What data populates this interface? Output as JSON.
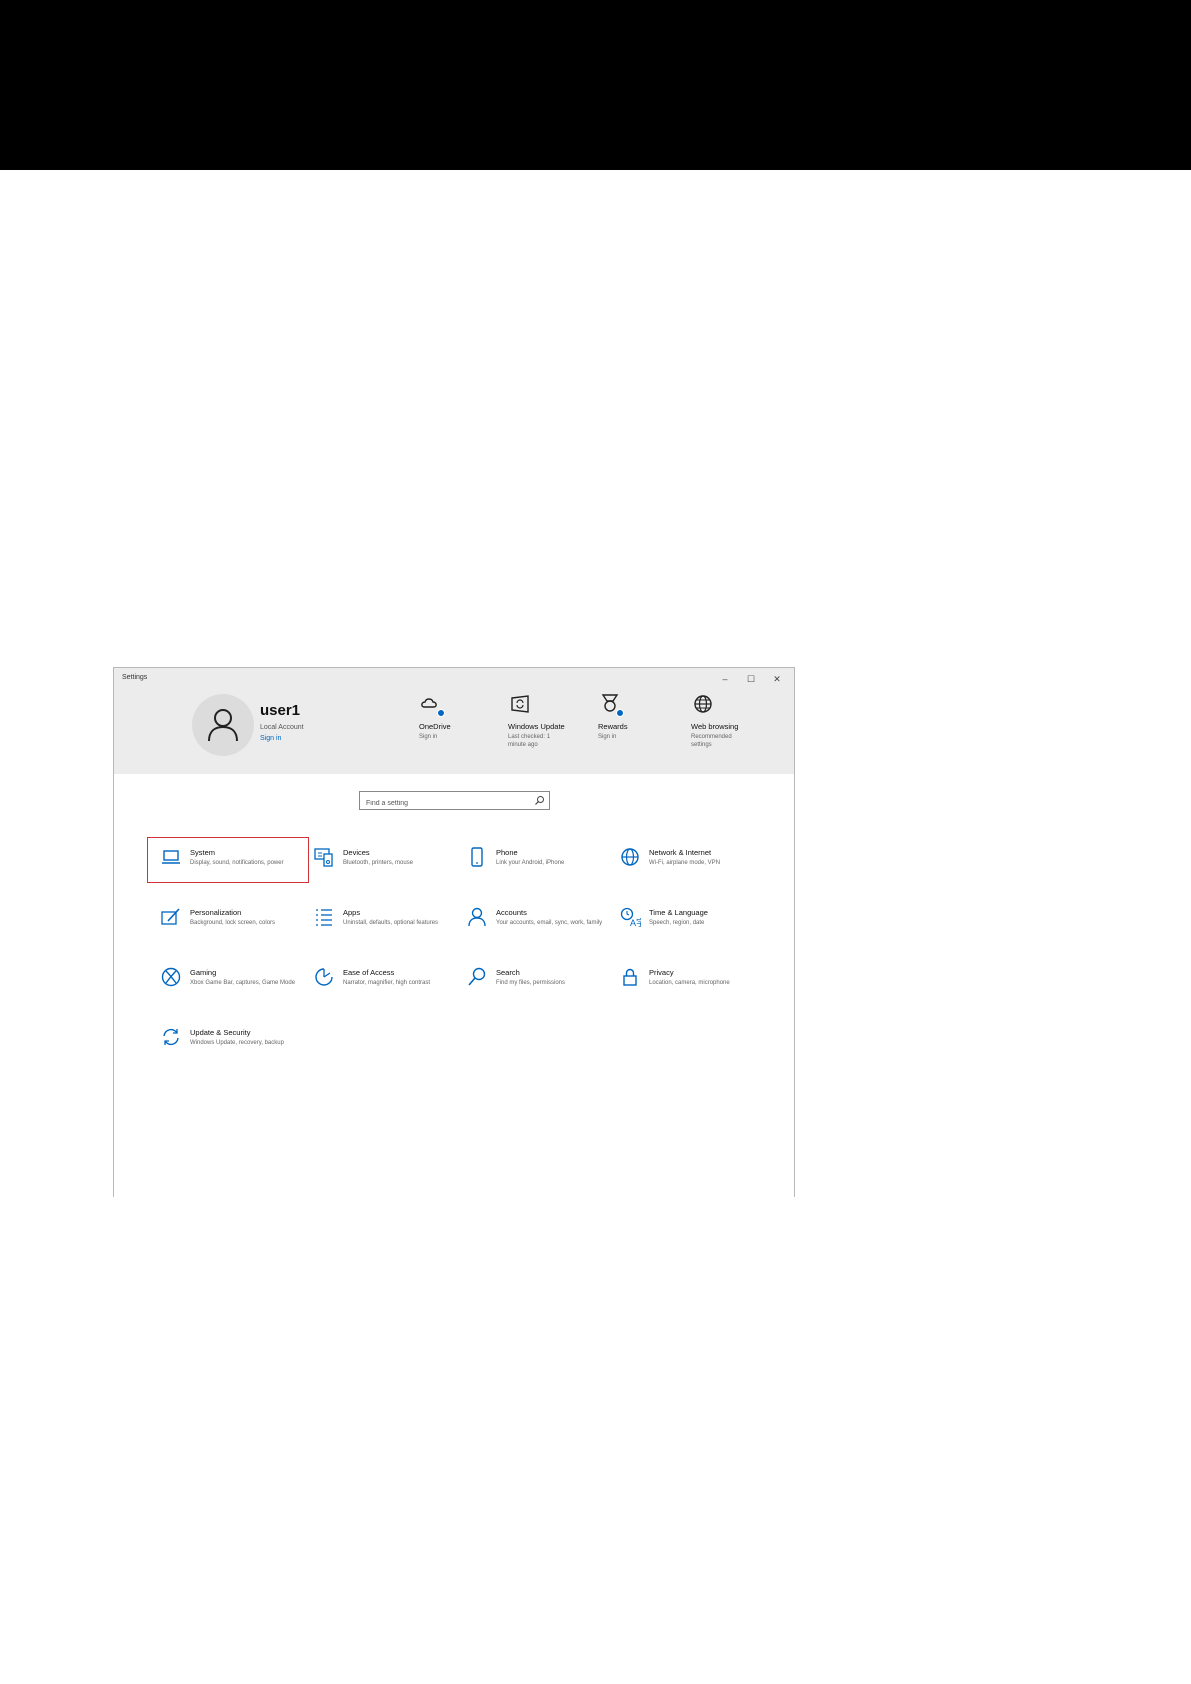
{
  "window": {
    "title": "Settings",
    "controls": {
      "minimize": "–",
      "maximize": "☐",
      "close": "✕"
    }
  },
  "account": {
    "name": "user1",
    "type": "Local Account",
    "signin": "Sign in"
  },
  "quick_links": [
    {
      "label": "OneDrive",
      "sub": "Sign in",
      "icon": "onedrive-cloud-icon"
    },
    {
      "label": "Windows Update",
      "sub": "Last checked: 1 minute ago",
      "icon": "windows-update-icon"
    },
    {
      "label": "Rewards",
      "sub": "Sign in",
      "icon": "rewards-medal-icon"
    },
    {
      "label": "Web browsing",
      "sub": "Recommended settings",
      "icon": "globe-icon"
    }
  ],
  "search": {
    "placeholder": "Find a setting"
  },
  "tiles": [
    {
      "name": "System",
      "desc": "Display, sound, notifications, power",
      "icon": "laptop-icon",
      "selected": true
    },
    {
      "name": "Devices",
      "desc": "Bluetooth, printers, mouse",
      "icon": "devices-icon"
    },
    {
      "name": "Phone",
      "desc": "Link your Android, iPhone",
      "icon": "phone-icon"
    },
    {
      "name": "Network & Internet",
      "desc": "Wi-Fi, airplane mode, VPN",
      "icon": "globe-icon"
    },
    {
      "name": "Personalization",
      "desc": "Background, lock screen, colors",
      "icon": "personalization-icon"
    },
    {
      "name": "Apps",
      "desc": "Uninstall, defaults, optional features",
      "icon": "apps-list-icon"
    },
    {
      "name": "Accounts",
      "desc": "Your accounts, email, sync, work, family",
      "icon": "person-icon"
    },
    {
      "name": "Time & Language",
      "desc": "Speech, region, date",
      "icon": "time-language-icon"
    },
    {
      "name": "Gaming",
      "desc": "Xbox Game Bar, captures, Game Mode",
      "icon": "xbox-icon"
    },
    {
      "name": "Ease of Access",
      "desc": "Narrator, magnifier, high contrast",
      "icon": "ease-of-access-icon"
    },
    {
      "name": "Search",
      "desc": "Find my files, permissions",
      "icon": "search-icon"
    },
    {
      "name": "Privacy",
      "desc": "Location, camera, microphone",
      "icon": "lock-icon"
    },
    {
      "name": "Update & Security",
      "desc": "Windows Update, recovery, backup",
      "icon": "sync-arrows-icon"
    }
  ],
  "colors": {
    "accent": "#0067c0",
    "highlight": "#d0323a",
    "header_bg": "#ececec"
  }
}
